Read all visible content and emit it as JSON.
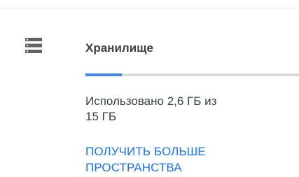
{
  "storage": {
    "icon": "storage-icon",
    "title": "Хранилище",
    "usage_line1": "Использовано 2,6 ГБ из",
    "usage_line2": "15 ГБ",
    "used_fraction": 0.17,
    "link_line1": "ПОЛУЧИТЬ БОЛЬШЕ",
    "link_line2": "ПРОСТРАНСТВА",
    "colors": {
      "accent": "#4285f4",
      "link": "#1a73e8",
      "track": "#dadce0",
      "text": "#3c4043",
      "icon": "#5f6368"
    }
  }
}
